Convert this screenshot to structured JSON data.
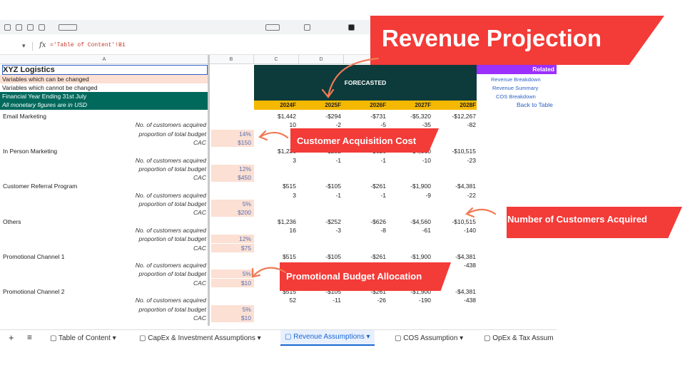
{
  "formula_bar": {
    "cell_ref": "",
    "fx_label": "fx",
    "formula": "='Table of Content'!B1"
  },
  "columns": {
    "a": "A",
    "b": "B",
    "c": "C",
    "d": "D"
  },
  "header": {
    "company": "XYZ Logistics",
    "var_changed": "Variables which can be changed",
    "var_not_changed": "Variables which cannot be changed",
    "fy_end": "Financial Year Ending 31st July",
    "currency_note": "All monetary figures are in USD",
    "forecasted": "FORECASTED",
    "years": [
      "2024F",
      "2025F",
      "2026F",
      "2027F",
      "2028F"
    ],
    "related_title": "Related",
    "related_links": [
      "Revenue Breakdown",
      "Revenue Summary",
      "COS Breakdown",
      "Back to Table"
    ]
  },
  "labels": {
    "customers": "No. of customers acquired",
    "proportion": "proportion of total budget",
    "cac": "CAC"
  },
  "channels": [
    {
      "name": "Email Marketing",
      "proportion": "14%",
      "cac": "$150",
      "revenue": [
        "$1,442",
        "-$294",
        "-$731",
        "-$5,320",
        "-$12,267"
      ],
      "customers": [
        "10",
        "-2",
        "-5",
        "-35",
        "-82"
      ]
    },
    {
      "name": "In Person Marketing",
      "proportion": "12%",
      "cac": "$450",
      "revenue": [
        "$1,236",
        "-$252",
        "-$626",
        "-$4,560",
        "-$10,515"
      ],
      "customers": [
        "3",
        "-1",
        "-1",
        "-10",
        "-23"
      ]
    },
    {
      "name": "Customer Referral Program",
      "proportion": "5%",
      "cac": "$200",
      "revenue": [
        "$515",
        "-$105",
        "-$261",
        "-$1,900",
        "-$4,381"
      ],
      "customers": [
        "3",
        "-1",
        "-1",
        "-9",
        "-22"
      ]
    },
    {
      "name": "Others",
      "proportion": "12%",
      "cac": "$75",
      "revenue": [
        "$1,236",
        "-$252",
        "-$626",
        "-$4,560",
        "-$10,515"
      ],
      "customers": [
        "16",
        "-3",
        "-8",
        "-61",
        "-140"
      ]
    },
    {
      "name": "Promotional Channel 1",
      "proportion": "5%",
      "cac": "$10",
      "revenue": [
        "$515",
        "-$105",
        "-$261",
        "-$1,900",
        "-$4,381"
      ],
      "customers": [
        "",
        "",
        "",
        "",
        "-438"
      ]
    },
    {
      "name": "Promotional Channel 2",
      "proportion": "5%",
      "cac": "$10",
      "revenue": [
        "$515",
        "-$105",
        "-$261",
        "-$1,900",
        "-$4,381"
      ],
      "customers": [
        "52",
        "-11",
        "-26",
        "-190",
        "-438"
      ]
    }
  ],
  "tabs": [
    "Table of Content",
    "CapEx & Investment Assumptions",
    "Revenue Assumptions",
    "COS Assumption",
    "OpEx & Tax Assum"
  ],
  "callouts": {
    "title": "Revenue Projection",
    "cac": "Customer Acquisition Cost",
    "customers": "Number of Customers  Acquired",
    "promo": "Promotional Budget Allocation"
  },
  "colors": {
    "accent": "#f33b38",
    "teal": "#00695c",
    "dark_teal": "#0d3b3b",
    "gold": "#f5b800",
    "purple": "#9b30ff",
    "input_fill": "#fbe0d3"
  }
}
